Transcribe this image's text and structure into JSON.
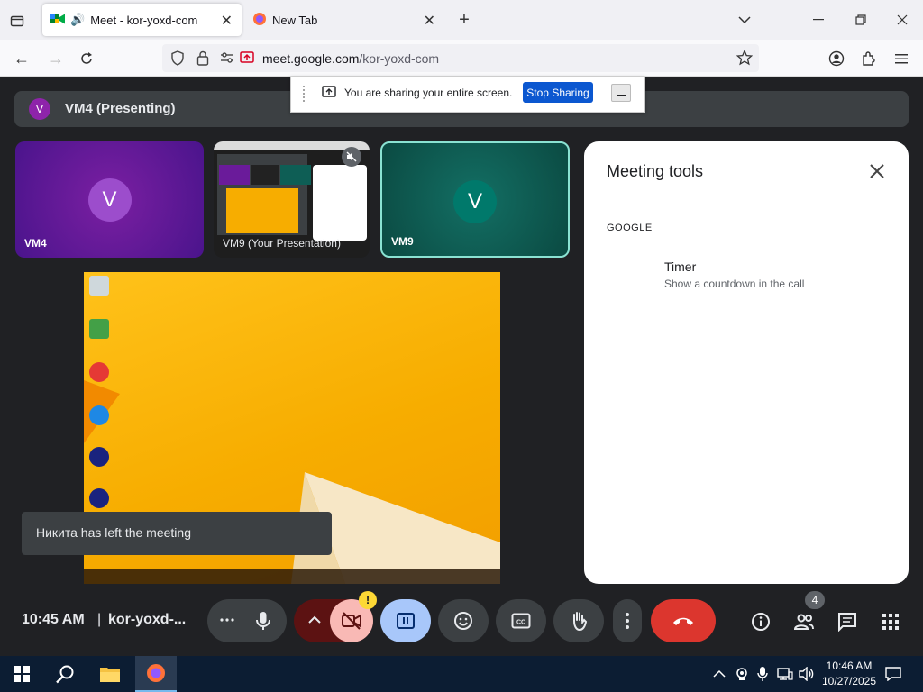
{
  "browser": {
    "tabs": [
      {
        "title": "Meet - kor-yoxd-com",
        "active": true
      },
      {
        "title": "New Tab",
        "active": false
      }
    ],
    "url_host": "meet.google.com",
    "url_path": "/kor-yoxd-com"
  },
  "share_banner": {
    "text": "You are sharing your entire screen.",
    "stop_label": "Stop Sharing"
  },
  "presenting": {
    "initial": "V",
    "label": "VM4 (Presenting)"
  },
  "tiles": [
    {
      "initial": "V",
      "name": "VM4",
      "color": "#6a1b9a"
    },
    {
      "name": "VM9 (Your Presentation)"
    },
    {
      "initial": "V",
      "name": "VM9",
      "color": "#0e5e55"
    }
  ],
  "toast": "Никита has left the meeting",
  "meeting_tools": {
    "title": "Meeting tools",
    "section": "GOOGLE",
    "tool_name": "Timer",
    "tool_desc": "Show a countdown in the call"
  },
  "controls": {
    "time": "10:45 AM",
    "separator": "|",
    "meeting_code": "kor-yoxd-...",
    "people_count": "4",
    "warning_mark": "!"
  },
  "taskbar": {
    "time": "10:46 AM",
    "date": "10/27/2025"
  }
}
